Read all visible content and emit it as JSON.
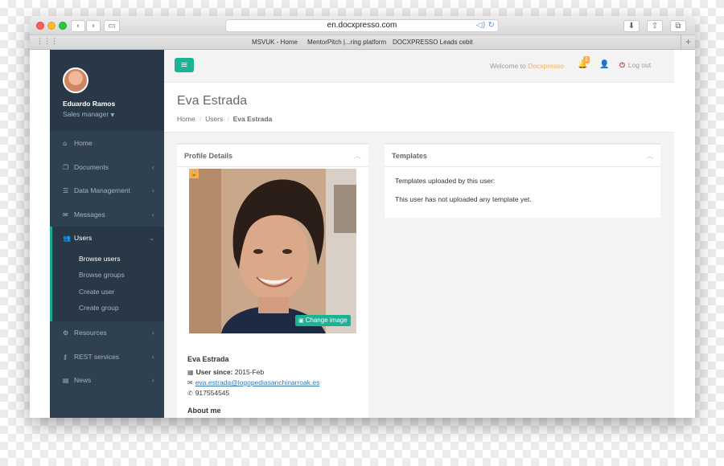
{
  "browser": {
    "url": "en.docxpresso.com",
    "bookmarks": [
      "MSVUK - Home",
      "MentorPitch |...ring platform",
      "DOCXPRESSO Leads cebit"
    ]
  },
  "sidebar": {
    "profile_name": "Eduardo Ramos",
    "profile_role": "Sales manager",
    "items": [
      {
        "label": "Home",
        "icon": "home-icon"
      },
      {
        "label": "Documents",
        "icon": "documents-icon"
      },
      {
        "label": "Data Management",
        "icon": "database-icon"
      },
      {
        "label": "Messages",
        "icon": "envelope-icon"
      },
      {
        "label": "Users",
        "icon": "users-icon"
      },
      {
        "label": "Resources",
        "icon": "cogs-icon"
      },
      {
        "label": "REST services",
        "icon": "key-icon"
      },
      {
        "label": "News",
        "icon": "newspaper-icon"
      }
    ],
    "users_subitems": [
      "Browse users",
      "Browse groups",
      "Create user",
      "Create group"
    ]
  },
  "topbar": {
    "welcome_prefix": "Welcome to",
    "brand": "Docxpresso",
    "notification_count": "1",
    "logout_label": "Log out"
  },
  "heading": {
    "title": "Eva Estrada",
    "breadcrumb": [
      "Home",
      "Users",
      "Eva Estrada"
    ]
  },
  "profile": {
    "panel_title": "Profile Details",
    "change_image_label": "Change image",
    "name": "Eva Estrada",
    "user_since_label": "User since:",
    "user_since_value": "2015-Feb",
    "email": "eva.estrada@logopediasanchinarroak.es",
    "phone": "917554545",
    "about_label": "About me"
  },
  "templates": {
    "panel_title": "Templates",
    "uploaded_label": "Templates uploaded by this user:",
    "empty_message": "This user has not uploaded any template yet."
  },
  "colors": {
    "sidebar_bg": "#2f4050",
    "accent_green": "#1ab394",
    "brand_orange": "#f8ac59",
    "logout_red": "#d9282c"
  }
}
